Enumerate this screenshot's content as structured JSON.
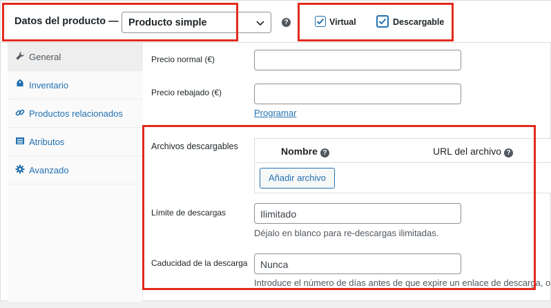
{
  "header": {
    "title": "Datos del producto —",
    "product_type": "Producto simple",
    "virtual_label": "Virtual",
    "downloadable_label": "Descargable",
    "virtual_checked": true,
    "downloadable_checked": true
  },
  "tabs": [
    {
      "label": "General",
      "icon": "wrench-icon",
      "active": true
    },
    {
      "label": "Inventario",
      "icon": "tag-icon",
      "active": false
    },
    {
      "label": "Productos relacionados",
      "icon": "link-icon",
      "active": false
    },
    {
      "label": "Atributos",
      "icon": "list-icon",
      "active": false
    },
    {
      "label": "Avanzado",
      "icon": "gear-icon",
      "active": false
    }
  ],
  "general": {
    "regular_price_label": "Precio normal (€)",
    "regular_price_value": "",
    "sale_price_label": "Precio rebajado (€)",
    "sale_price_value": "",
    "schedule_link": "Programar"
  },
  "downloads": {
    "files_label": "Archivos descargables",
    "col_name": "Nombre",
    "col_url": "URL del archivo",
    "add_file_button": "Añadir archivo",
    "limit_label": "Límite de descargas",
    "limit_placeholder": "Ilimitado",
    "limit_desc": "Déjalo en blanco para re-descargas ilimitadas.",
    "expiry_label": "Caducidad de la descarga",
    "expiry_placeholder": "Nunca",
    "expiry_desc": "Introduce el número de días antes de que expire un enlace de descarga, o"
  },
  "colors": {
    "accent": "#2271b1",
    "annotation": "#e12a1c"
  }
}
